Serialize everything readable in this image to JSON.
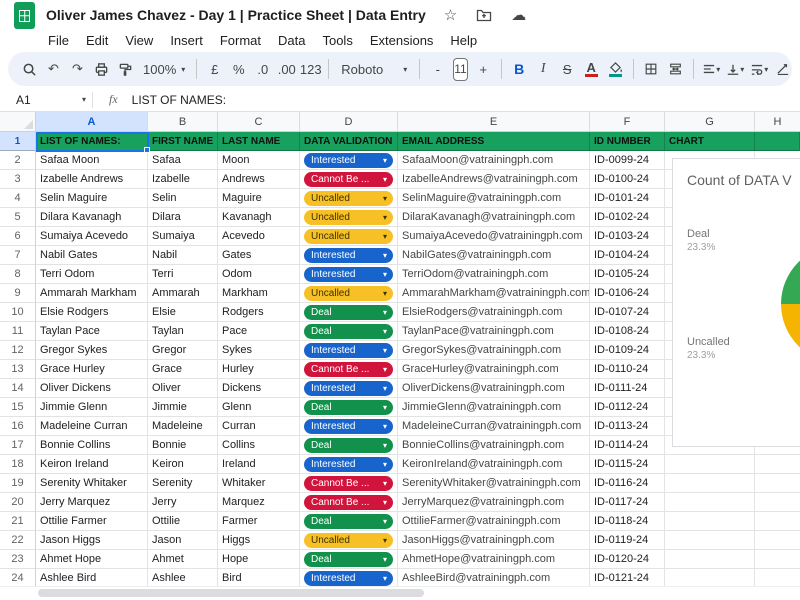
{
  "app": {
    "title": "Oliver James Chavez - Day 1 | Practice Sheet | Data Entry"
  },
  "menus": [
    "File",
    "Edit",
    "View",
    "Insert",
    "Format",
    "Data",
    "Tools",
    "Extensions",
    "Help"
  ],
  "toolbar": {
    "zoom": "100%",
    "currency": "£",
    "percent": "%",
    "dec0": ".0",
    "dec00": ".00",
    "fmt123": "123",
    "font": "Roboto",
    "minus": "-",
    "size": "11",
    "plus": "+",
    "bold": "B",
    "italic": "I",
    "strike": "S",
    "textcolor": "A"
  },
  "formula": {
    "cell": "A1",
    "fx": "fx",
    "value": "LIST OF NAMES:"
  },
  "col_letters": [
    "A",
    "B",
    "C",
    "D",
    "E",
    "F",
    "G",
    "H"
  ],
  "header": {
    "row_num": "1",
    "names": "LIST OF NAMES:",
    "first": "FIRST NAME",
    "last": "LAST NAME",
    "validation": "DATA VALIDATION",
    "email": "EMAIL ADDRESS",
    "id": "ID NUMBER",
    "chart": "CHART"
  },
  "colors": {
    "header_bg": "#17a05e",
    "selection": "#1a73e8",
    "col_sel_bg": "#d3e3fd",
    "a1_text": "#ffd43a"
  },
  "chip_labels": {
    "interested": "Interested",
    "cannot": "Cannot Be ...",
    "uncalled": "Uncalled",
    "deal": "Deal"
  },
  "chip_colors": {
    "interested": "#1765cc",
    "cannot": "#d0143c",
    "uncalled": "#f6c026",
    "deal": "#12914d"
  },
  "chip_text": {
    "interested": "#ffffff",
    "cannot": "#ffffff",
    "uncalled": "#3d3100",
    "deal": "#ffffff"
  },
  "rows": [
    {
      "n": "2",
      "name": "Safaa Moon",
      "first": "Safaa",
      "last": "Moon",
      "status": "interested",
      "email": "SafaaMoon@vatrainingph.com",
      "id": "ID-0099-24"
    },
    {
      "n": "3",
      "name": "Izabelle Andrews",
      "first": "Izabelle",
      "last": "Andrews",
      "status": "cannot",
      "email": "IzabelleAndrews@vatrainingph.com",
      "id": "ID-0100-24"
    },
    {
      "n": "4",
      "name": "Selin Maguire",
      "first": "Selin",
      "last": "Maguire",
      "status": "uncalled",
      "email": "SelinMaguire@vatrainingph.com",
      "id": "ID-0101-24"
    },
    {
      "n": "5",
      "name": "Dilara Kavanagh",
      "first": "Dilara",
      "last": "Kavanagh",
      "status": "uncalled",
      "email": "DilaraKavanagh@vatrainingph.com",
      "id": "ID-0102-24"
    },
    {
      "n": "6",
      "name": "Sumaiya Acevedo",
      "first": "Sumaiya",
      "last": "Acevedo",
      "status": "uncalled",
      "email": "SumaiyaAcevedo@vatrainingph.com",
      "id": "ID-0103-24"
    },
    {
      "n": "7",
      "name": "Nabil Gates",
      "first": "Nabil",
      "last": "Gates",
      "status": "interested",
      "email": "NabilGates@vatrainingph.com",
      "id": "ID-0104-24"
    },
    {
      "n": "8",
      "name": "Terri Odom",
      "first": "Terri",
      "last": "Odom",
      "status": "interested",
      "email": "TerriOdom@vatrainingph.com",
      "id": "ID-0105-24"
    },
    {
      "n": "9",
      "name": "Ammarah Markham",
      "first": "Ammarah",
      "last": "Markham",
      "status": "uncalled",
      "email": "AmmarahMarkham@vatrainingph.com",
      "id": "ID-0106-24"
    },
    {
      "n": "10",
      "name": "Elsie Rodgers",
      "first": "Elsie",
      "last": "Rodgers",
      "status": "deal",
      "email": "ElsieRodgers@vatrainingph.com",
      "id": "ID-0107-24"
    },
    {
      "n": "11",
      "name": "Taylan Pace",
      "first": "Taylan",
      "last": "Pace",
      "status": "deal",
      "email": "TaylanPace@vatrainingph.com",
      "id": "ID-0108-24"
    },
    {
      "n": "12",
      "name": "Gregor Sykes",
      "first": "Gregor",
      "last": "Sykes",
      "status": "interested",
      "email": "GregorSykes@vatrainingph.com",
      "id": "ID-0109-24"
    },
    {
      "n": "13",
      "name": "Grace Hurley",
      "first": "Grace",
      "last": "Hurley",
      "status": "cannot",
      "email": "GraceHurley@vatrainingph.com",
      "id": "ID-0110-24"
    },
    {
      "n": "14",
      "name": "Oliver Dickens",
      "first": "Oliver",
      "last": "Dickens",
      "status": "interested",
      "email": "OliverDickens@vatrainingph.com",
      "id": "ID-0111-24"
    },
    {
      "n": "15",
      "name": "Jimmie Glenn",
      "first": "Jimmie",
      "last": "Glenn",
      "status": "deal",
      "email": "JimmieGlenn@vatrainingph.com",
      "id": "ID-0112-24"
    },
    {
      "n": "16",
      "name": "Madeleine Curran",
      "first": "Madeleine",
      "last": "Curran",
      "status": "interested",
      "email": "MadeleineCurran@vatrainingph.com",
      "id": "ID-0113-24"
    },
    {
      "n": "17",
      "name": "Bonnie Collins",
      "first": "Bonnie",
      "last": "Collins",
      "status": "deal",
      "email": "BonnieCollins@vatrainingph.com",
      "id": "ID-0114-24"
    },
    {
      "n": "18",
      "name": "Keiron Ireland",
      "first": "Keiron",
      "last": "Ireland",
      "status": "interested",
      "email": "KeironIreland@vatrainingph.com",
      "id": "ID-0115-24"
    },
    {
      "n": "19",
      "name": "Serenity Whitaker",
      "first": "Serenity",
      "last": "Whitaker",
      "status": "cannot",
      "email": "SerenityWhitaker@vatrainingph.com",
      "id": "ID-0116-24"
    },
    {
      "n": "20",
      "name": "Jerry Marquez",
      "first": "Jerry",
      "last": "Marquez",
      "status": "cannot",
      "email": "JerryMarquez@vatrainingph.com",
      "id": "ID-0117-24"
    },
    {
      "n": "21",
      "name": "Ottilie Farmer",
      "first": "Ottilie",
      "last": "Farmer",
      "status": "deal",
      "email": "OttilieFarmer@vatrainingph.com",
      "id": "ID-0118-24"
    },
    {
      "n": "22",
      "name": "Jason Higgs",
      "first": "Jason",
      "last": "Higgs",
      "status": "uncalled",
      "email": "JasonHiggs@vatrainingph.com",
      "id": "ID-0119-24"
    },
    {
      "n": "23",
      "name": "Ahmet Hope",
      "first": "Ahmet",
      "last": "Hope",
      "status": "deal",
      "email": "AhmetHope@vatrainingph.com",
      "id": "ID-0120-24"
    },
    {
      "n": "24",
      "name": "Ashlee Bird",
      "first": "Ashlee",
      "last": "Bird",
      "status": "interested",
      "email": "AshleeBird@vatrainingph.com",
      "id": "ID-0121-24"
    }
  ],
  "chart": {
    "title": "Count of DATA V",
    "slices": [
      {
        "label": "Deal",
        "pct": "23.3%"
      },
      {
        "label": "Uncalled",
        "pct": "23.3%"
      }
    ],
    "pie_colors": {
      "green": "#34a853",
      "yellow": "#f4b400"
    }
  }
}
